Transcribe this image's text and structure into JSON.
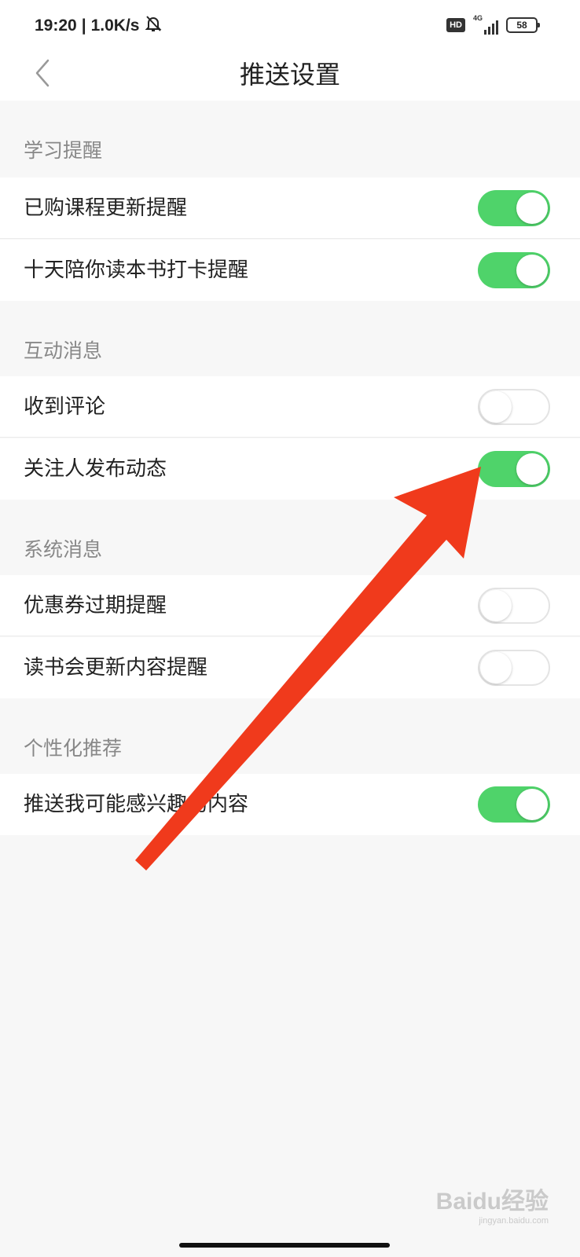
{
  "status_bar": {
    "time": "19:20",
    "separator": "|",
    "speed": "1.0K/s",
    "hd": "HD",
    "network": "4G",
    "battery": "58",
    "icons": [
      "bell-muted-icon",
      "hd-icon",
      "signal-icon",
      "battery-icon"
    ]
  },
  "header": {
    "back_icon": "chevron-left-icon",
    "title": "推送设置"
  },
  "sections": [
    {
      "title": "学习提醒",
      "items": [
        {
          "label": "已购课程更新提醒",
          "on": true
        },
        {
          "label": "十天陪你读本书打卡提醒",
          "on": true
        }
      ]
    },
    {
      "title": "互动消息",
      "items": [
        {
          "label": "收到评论",
          "on": false
        },
        {
          "label": "关注人发布动态",
          "on": true
        }
      ]
    },
    {
      "title": "系统消息",
      "items": [
        {
          "label": "优惠券过期提醒",
          "on": false
        },
        {
          "label": "读书会更新内容提醒",
          "on": false
        }
      ]
    },
    {
      "title": "个性化推荐",
      "items": [
        {
          "label": "推送我可能感兴趣的内容",
          "on": true
        }
      ]
    }
  ],
  "watermark": {
    "main": "Baidu经验",
    "sub": "jingyan.baidu.com"
  },
  "colors": {
    "toggle_on": "#4fd36a",
    "toggle_off_border": "#e4e4e4",
    "annotation_arrow": "#f03a1c",
    "background": "#f7f7f7"
  }
}
